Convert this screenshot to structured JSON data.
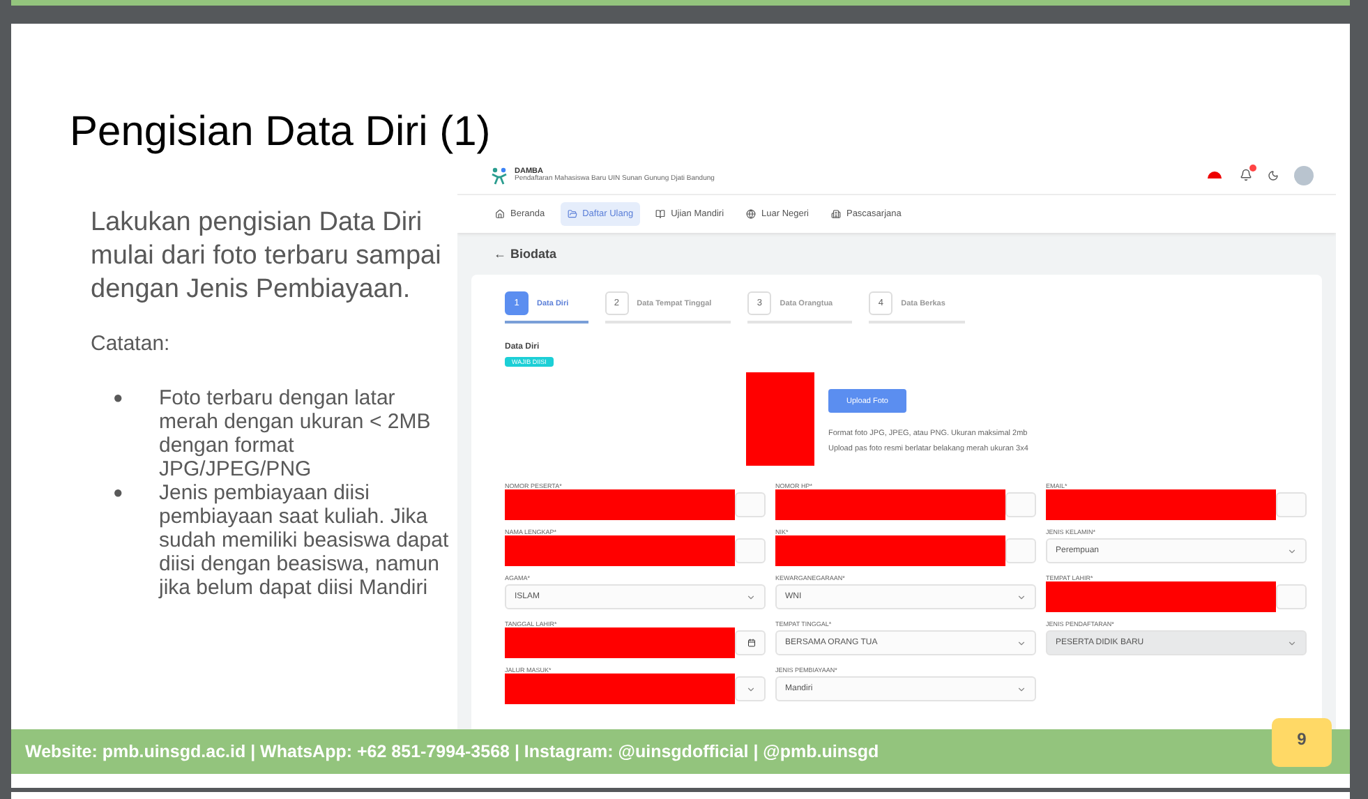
{
  "slide": {
    "title": "Pengisian Data Diri (1)",
    "intro": "Lakukan pengisian Data Diri mulai dari foto terbaru sampai dengan Jenis Pembiayaan.",
    "note_heading": "Catatan:",
    "bullet_mark": "●",
    "notes": [
      "Foto terbaru dengan latar merah dengan ukuran < 2MB dengan format JPG/JPEG/PNG",
      "Jenis pembiayaan diisi pembiayaan saat kuliah. Jika sudah memiliki beasiswa dapat diisi dengan beasiswa, namun jika belum dapat diisi Mandiri"
    ],
    "footer": "Website: pmb.uinsgd.ac.id | WhatsApp: +62 851-7994-3568 | Instagram: @uinsgdofficial | @pmb.uinsgd",
    "page_number": "9"
  },
  "app": {
    "brand": {
      "name": "DAMBA",
      "subtitle": "Pendaftaran Mahasiswa Baru UIN Sunan Gunung Djati Bandung"
    },
    "nav": [
      {
        "label": "Beranda",
        "selected": false
      },
      {
        "label": "Daftar Ulang",
        "selected": true
      },
      {
        "label": "Ujian Mandiri",
        "selected": false
      },
      {
        "label": "Luar Negeri",
        "selected": false
      },
      {
        "label": "Pascasarjana",
        "selected": false
      }
    ],
    "back_arrow": "←",
    "page_title": "Biodata",
    "steps": [
      {
        "number": "1",
        "label": "Data Diri",
        "selected": true
      },
      {
        "number": "2",
        "label": "Data Tempat Tinggal",
        "selected": false
      },
      {
        "number": "3",
        "label": "Data Orangtua",
        "selected": false
      },
      {
        "number": "4",
        "label": "Data Berkas",
        "selected": false
      }
    ],
    "section_title": "Data Diri",
    "required_badge": "WAJIB DIISI",
    "upload_button": "Upload Foto",
    "upload_hints": [
      "Format foto JPG, JPEG, atau PNG. Ukuran maksimal 2mb",
      "Upload pas foto resmi berlatar belakang merah ukuran 3x4"
    ],
    "fields": [
      {
        "label": "NOMOR PESERTA*",
        "kind": "text",
        "redacted": true
      },
      {
        "label": "NOMOR HP*",
        "kind": "text",
        "redacted": true
      },
      {
        "label": "EMAIL*",
        "kind": "text",
        "redacted": true
      },
      {
        "label": "NAMA LENGKAP*",
        "kind": "text",
        "redacted": true
      },
      {
        "label": "NIK*",
        "kind": "text",
        "redacted": true
      },
      {
        "label": "JENIS KELAMIN*",
        "kind": "select",
        "value": "Perempuan",
        "redacted": false,
        "disabled": false
      },
      {
        "label": "AGAMA*",
        "kind": "select",
        "value": "ISLAM",
        "redacted": false,
        "disabled": false
      },
      {
        "label": "KEWARGANEGARAAN*",
        "kind": "select",
        "value": "WNI",
        "redacted": false,
        "disabled": false
      },
      {
        "label": "TEMPAT LAHIR*",
        "kind": "text",
        "redacted": true
      },
      {
        "label": "TANGGAL LAHIR*",
        "kind": "date",
        "redacted": true
      },
      {
        "label": "TEMPAT TINGGAL*",
        "kind": "select",
        "value": "BERSAMA ORANG TUA",
        "redacted": false,
        "disabled": false
      },
      {
        "label": "JENIS PENDAFTARAN*",
        "kind": "select",
        "value": "PESERTA DIDIK BARU",
        "redacted": false,
        "disabled": true
      },
      {
        "label": "JALUR MASUK*",
        "kind": "select",
        "redacted": true
      },
      {
        "label": "JENIS PEMBIAYAAN*",
        "kind": "select",
        "value": "Mandiri",
        "redacted": false,
        "disabled": false
      }
    ]
  }
}
